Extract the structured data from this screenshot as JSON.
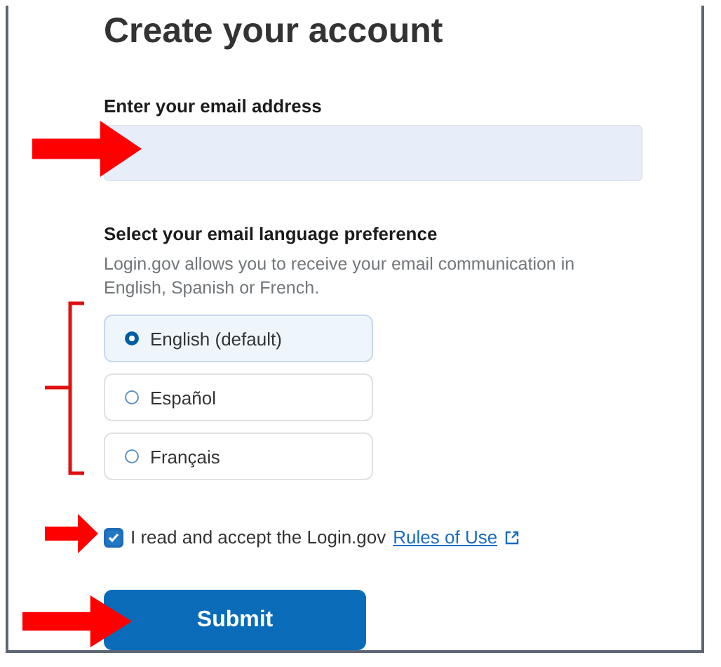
{
  "title": "Create your account",
  "email": {
    "label": "Enter your email address"
  },
  "language": {
    "heading": "Select your email language preference",
    "description": "Login.gov allows you to receive your email communication in English, Spanish or French.",
    "options": [
      {
        "label": "English (default)",
        "selected": true
      },
      {
        "label": "Español",
        "selected": false
      },
      {
        "label": "Français",
        "selected": false
      }
    ]
  },
  "terms": {
    "checked": true,
    "text": "I read and accept the Login.gov",
    "link": "Rules of Use"
  },
  "submit": "Submit"
}
